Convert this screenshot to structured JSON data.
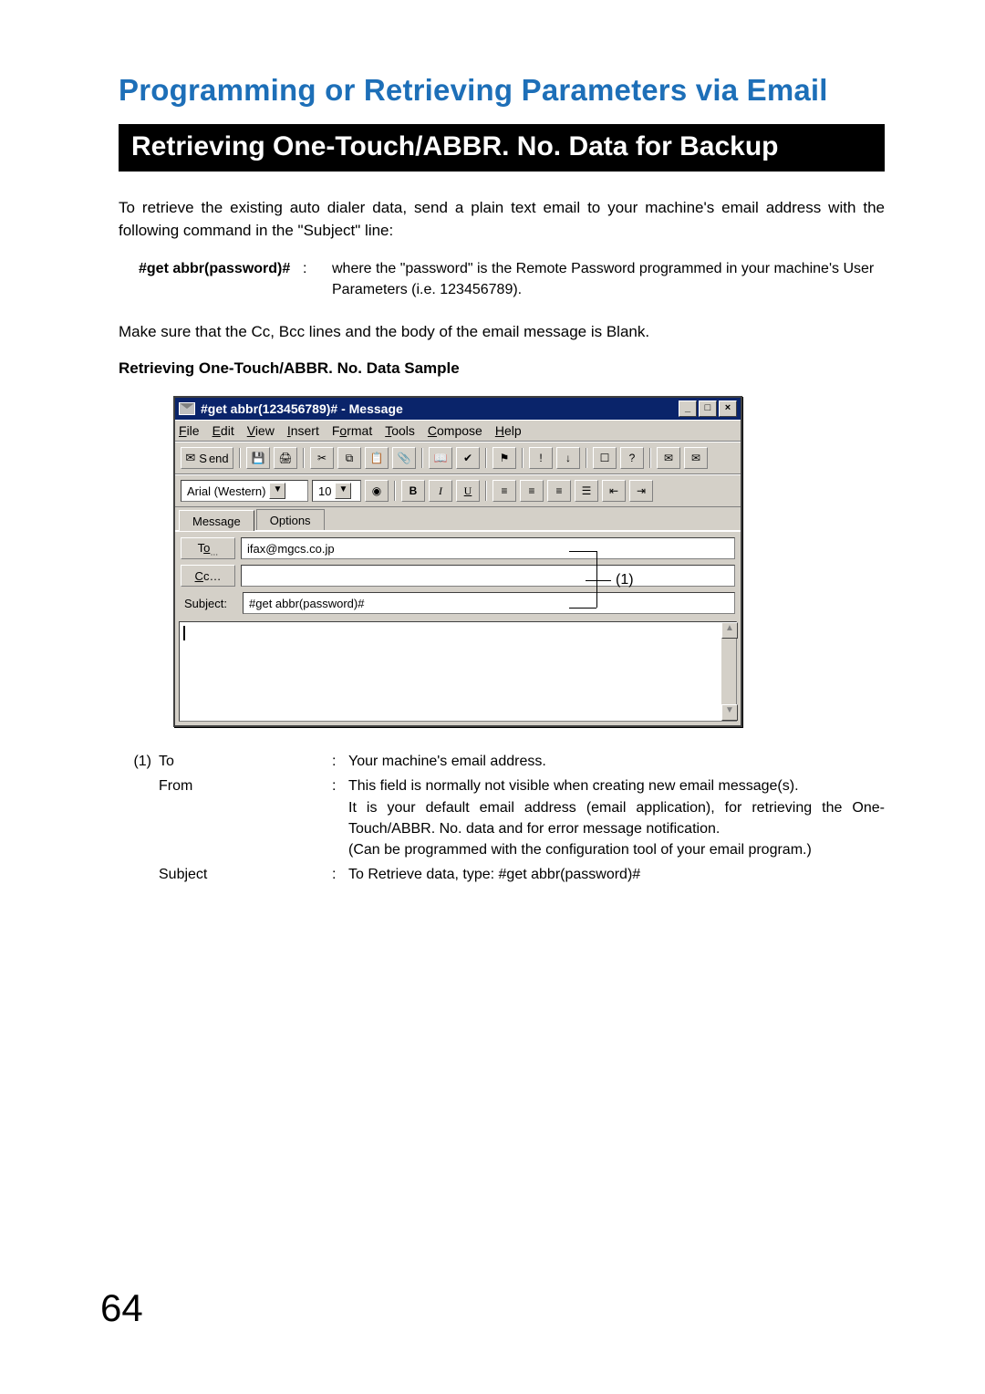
{
  "heading1": "Programming or Retrieving Parameters via Email",
  "heading2": "Retrieving One-Touch/ABBR. No. Data for Backup",
  "intro": "To retrieve the existing auto dialer data, send a plain text email to your machine's email address with the following command in the \"Subject\" line:",
  "command": {
    "label": "#get abbr(password)#",
    "colon": ":",
    "desc": "where the \"password\" is the Remote Password programmed in your machine's User Parameters (i.e. 123456789)."
  },
  "blank_note": "Make sure that the Cc, Bcc lines and the body of the email message is Blank.",
  "sample_heading": "Retrieving One-Touch/ABBR. No. Data Sample",
  "email": {
    "title": "#get abbr(123456789)# - Message",
    "menu": {
      "file": "File",
      "edit": "Edit",
      "view": "View",
      "insert": "Insert",
      "format": "Format",
      "tools": "Tools",
      "compose": "Compose",
      "help": "Help"
    },
    "send": "Send",
    "font": "Arial (Western)",
    "size": "10",
    "bold": "B",
    "italic": "I",
    "underline": "U",
    "tabs": {
      "message": "Message",
      "options": "Options"
    },
    "to_label": "To…",
    "to_value": "ifax@mgcs.co.jp",
    "cc_label": "Cc…",
    "cc_value": "",
    "subject_label": "Subject:",
    "subject_value": "#get abbr(password)#"
  },
  "callout": "(1)",
  "defs": {
    "num": "(1)",
    "rows": [
      {
        "label": "To",
        "desc": "Your machine's email address."
      },
      {
        "label": "From",
        "desc": "This field is normally not visible when creating new email message(s).\nIt is your default email address (email application), for retrieving the One-Touch/ABBR. No. data and for error message notification.\n(Can be programmed with the configuration tool of your email program.)"
      },
      {
        "label": "Subject",
        "desc": "To Retrieve data, type: #get abbr(password)#"
      }
    ],
    "colon": ":"
  },
  "page_number": "64"
}
